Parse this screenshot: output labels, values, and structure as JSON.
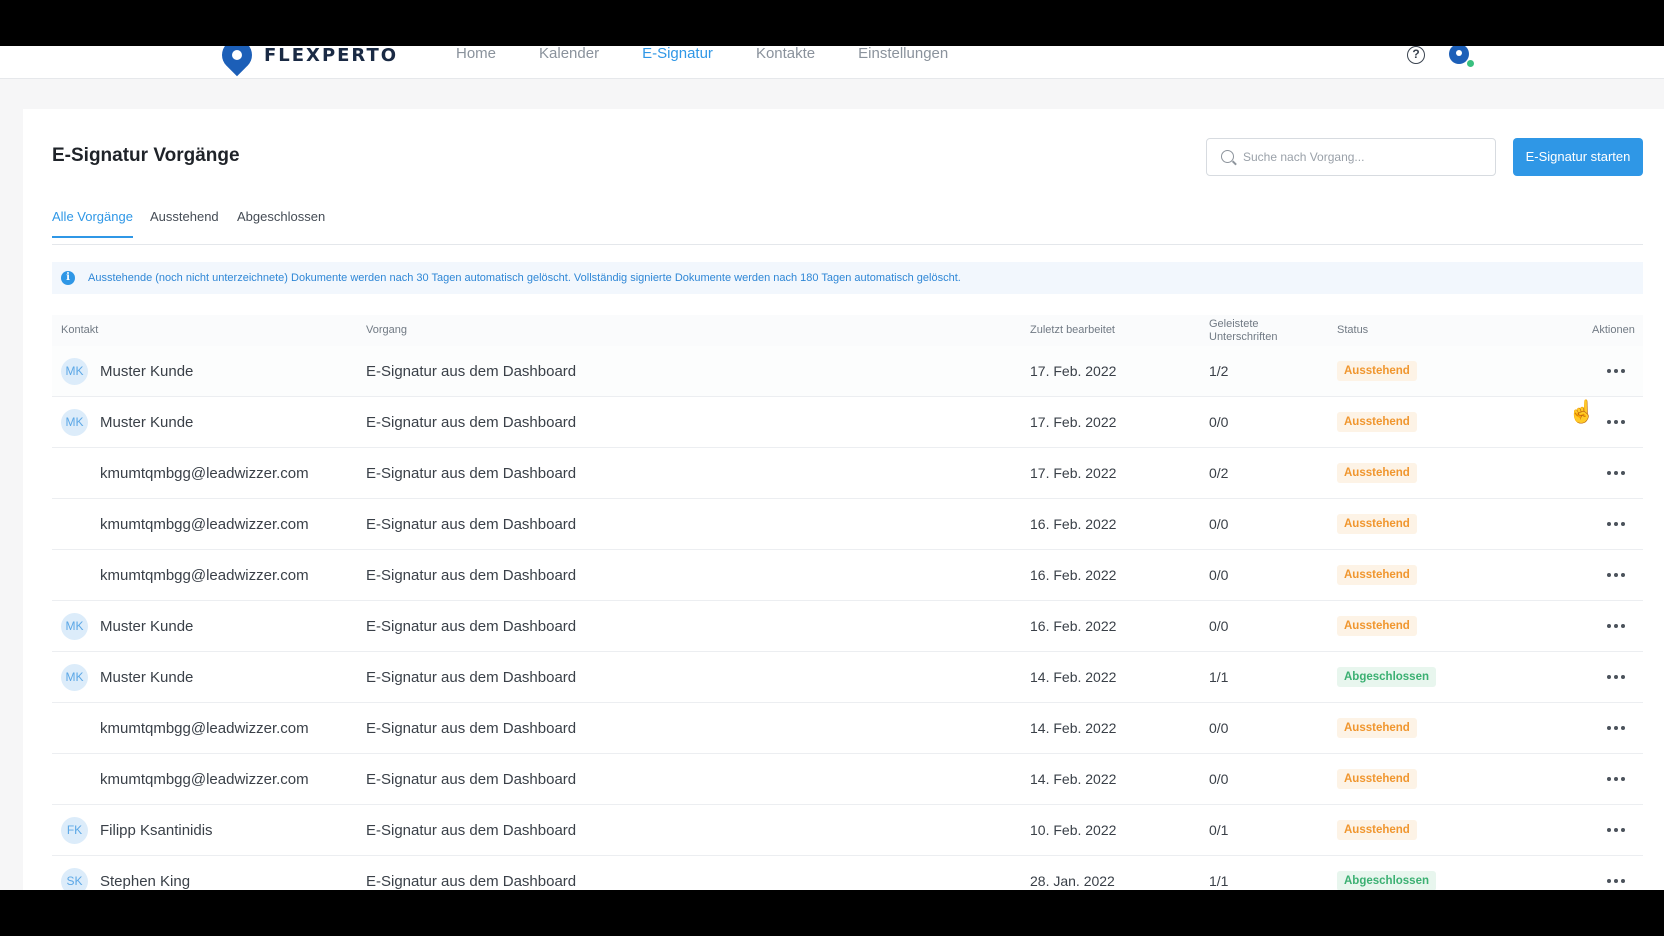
{
  "navbar": {
    "brand": "FLEXPERTO",
    "links": [
      "Home",
      "Kalender",
      "E-Signatur",
      "Kontakte",
      "Einstellungen"
    ],
    "active_link": "E-Signatur",
    "help_glyph": "?"
  },
  "page": {
    "title": "E-Signatur Vorgänge",
    "search_placeholder": "Suche nach Vorgang...",
    "primary_button": "E-Signatur starten"
  },
  "tabs": [
    "Alle Vorgänge",
    "Ausstehend",
    "Abgeschlossen"
  ],
  "active_tab": "Alle Vorgänge",
  "info": {
    "icon": "info-icon",
    "glyph": "i",
    "text": "Ausstehende (noch nicht unterzeichnete) Dokumente werden nach 30 Tagen automatisch gelöscht. Vollständig signierte Dokumente werden nach 180 Tagen automatisch gelöscht."
  },
  "table": {
    "headers": {
      "contact": "Kontakt",
      "process": "Vorgang",
      "date": "Zuletzt bearbeitet",
      "signatures": "Geleistete Unterschriften",
      "status": "Status",
      "actions": "Aktionen"
    },
    "rows": [
      {
        "initials": "MK",
        "contact": "Muster Kunde",
        "process": "E-Signatur aus dem Dashboard",
        "date": "17. Feb. 2022",
        "signatures": "1/2",
        "status": "Ausstehend",
        "done": false
      },
      {
        "initials": "MK",
        "contact": "Muster Kunde",
        "process": "E-Signatur aus dem Dashboard",
        "date": "17. Feb. 2022",
        "signatures": "0/0",
        "status": "Ausstehend",
        "done": false
      },
      {
        "initials": "",
        "contact": "kmumtqmbgg@leadwizzer.com",
        "process": "E-Signatur aus dem Dashboard",
        "date": "17. Feb. 2022",
        "signatures": "0/2",
        "status": "Ausstehend",
        "done": false
      },
      {
        "initials": "",
        "contact": "kmumtqmbgg@leadwizzer.com",
        "process": "E-Signatur aus dem Dashboard",
        "date": "16. Feb. 2022",
        "signatures": "0/0",
        "status": "Ausstehend",
        "done": false
      },
      {
        "initials": "",
        "contact": "kmumtqmbgg@leadwizzer.com",
        "process": "E-Signatur aus dem Dashboard",
        "date": "16. Feb. 2022",
        "signatures": "0/0",
        "status": "Ausstehend",
        "done": false
      },
      {
        "initials": "MK",
        "contact": "Muster Kunde",
        "process": "E-Signatur aus dem Dashboard",
        "date": "16. Feb. 2022",
        "signatures": "0/0",
        "status": "Ausstehend",
        "done": false
      },
      {
        "initials": "MK",
        "contact": "Muster Kunde",
        "process": "E-Signatur aus dem Dashboard",
        "date": "14. Feb. 2022",
        "signatures": "1/1",
        "status": "Abgeschlossen",
        "done": true
      },
      {
        "initials": "",
        "contact": "kmumtqmbgg@leadwizzer.com",
        "process": "E-Signatur aus dem Dashboard",
        "date": "14. Feb. 2022",
        "signatures": "0/0",
        "status": "Ausstehend",
        "done": false
      },
      {
        "initials": "",
        "contact": "kmumtqmbgg@leadwizzer.com",
        "process": "E-Signatur aus dem Dashboard",
        "date": "14. Feb. 2022",
        "signatures": "0/0",
        "status": "Ausstehend",
        "done": false
      },
      {
        "initials": "FK",
        "contact": "Filipp Ksantinidis",
        "process": "E-Signatur aus dem Dashboard",
        "date": "10. Feb. 2022",
        "signatures": "0/1",
        "status": "Ausstehend",
        "done": false
      },
      {
        "initials": "SK",
        "contact": "Stephen King",
        "process": "E-Signatur aus dem Dashboard",
        "date": "28. Jan. 2022",
        "signatures": "1/1",
        "status": "Abgeschlossen",
        "done": true
      }
    ]
  },
  "colors": {
    "accent": "#2f97e6",
    "pending": "#f0962e",
    "done": "#3bb072",
    "brand": "#1c5fb8"
  }
}
